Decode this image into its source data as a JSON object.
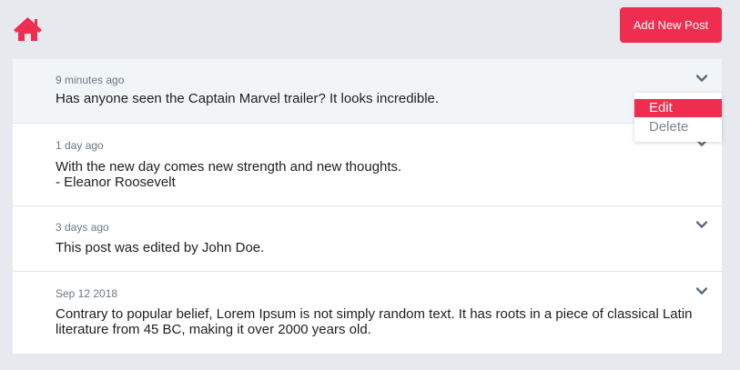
{
  "header": {
    "home_icon": "home-icon",
    "add_button_label": "Add New Post"
  },
  "colors": {
    "accent": "#ef2d4e",
    "background": "#e6e9ee",
    "muted_text": "#6b7785"
  },
  "posts": [
    {
      "timestamp": "9 minutes ago",
      "text": "Has anyone seen the Captain Marvel trailer? It looks incredible."
    },
    {
      "timestamp": "1 day ago",
      "text": "With the new day comes new strength and new thoughts.\n- Eleanor Roosevelt"
    },
    {
      "timestamp": "3 days ago",
      "text": "This post was edited by John Doe."
    },
    {
      "timestamp": "Sep 12 2018",
      "text": "Contrary to popular belief, Lorem Ipsum is not simply random text. It has roots in a piece of classical Latin literature from 45 BC, making it over 2000 years old."
    }
  ],
  "dropdown": {
    "edit_label": "Edit",
    "delete_label": "Delete"
  }
}
